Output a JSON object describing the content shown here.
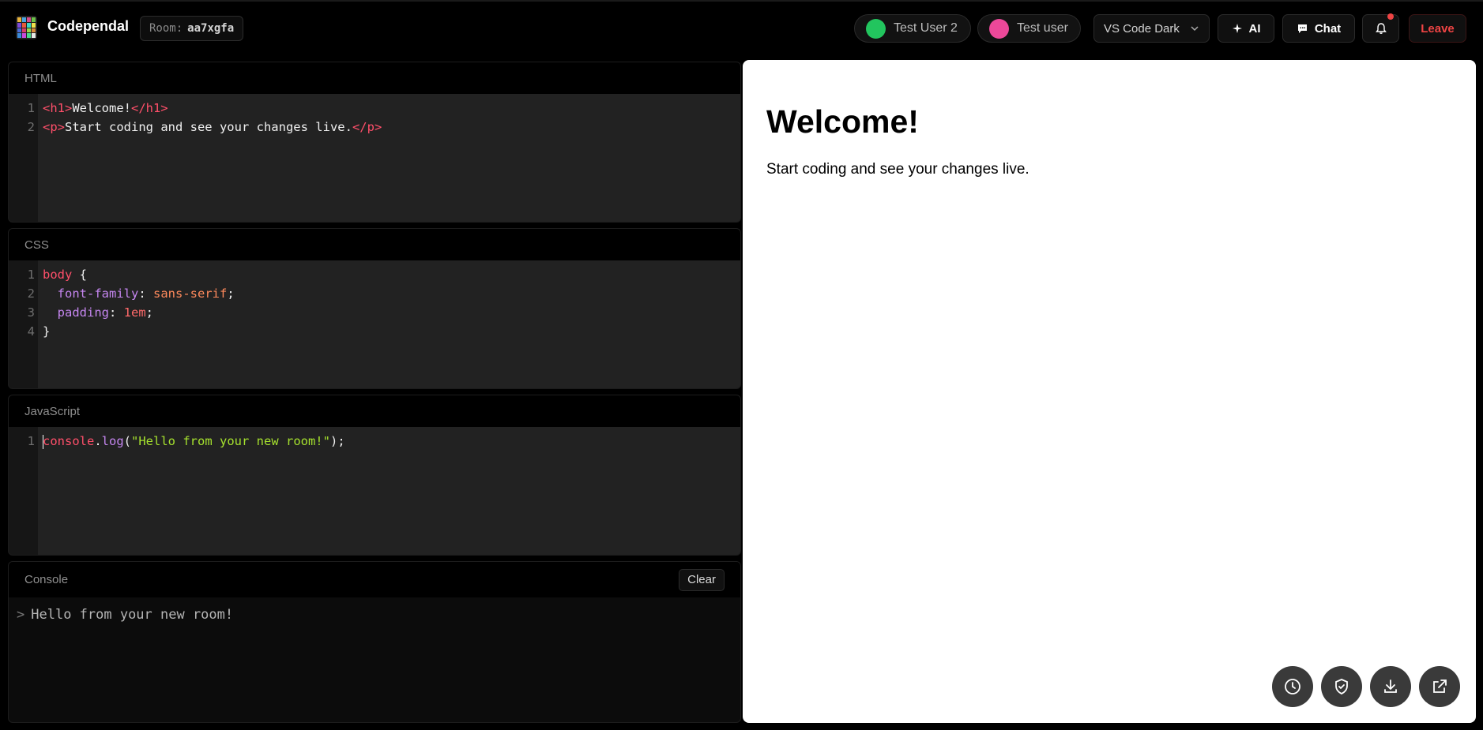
{
  "app": {
    "name": "Codependal",
    "room_label": "Room:",
    "room_id": "aa7xgfa"
  },
  "users": [
    {
      "name": "Test User 2",
      "color": "#22c55e"
    },
    {
      "name": "Test user",
      "color": "#ec4899"
    }
  ],
  "toolbar": {
    "theme": "VS Code Dark",
    "ai_label": "AI",
    "chat_label": "Chat",
    "leave_label": "Leave"
  },
  "panels": {
    "html_title": "HTML",
    "css_title": "CSS",
    "js_title": "JavaScript",
    "console_title": "Console",
    "clear_label": "Clear"
  },
  "html_code": {
    "line1": {
      "no": "1",
      "open": "<h1>",
      "text": "Welcome!",
      "close": "</h1>"
    },
    "line2": {
      "no": "2",
      "open": "<p>",
      "text": "Start coding and see your changes live.",
      "close": "</p>"
    }
  },
  "css_code": {
    "line1": {
      "no": "1",
      "selector": "body",
      "rest": " {"
    },
    "line2": {
      "no": "2",
      "prop": "font-family",
      "value": "sans-serif"
    },
    "line3": {
      "no": "3",
      "prop": "padding",
      "value": "1em"
    },
    "line4": {
      "no": "4",
      "text": "}"
    }
  },
  "js_code": {
    "line1": {
      "no": "1",
      "obj": "console",
      "method": "log",
      "arg": "\"Hello from your new room!\""
    }
  },
  "console_output": {
    "prompt": ">",
    "message": "Hello from your new room!"
  },
  "preview": {
    "heading": "Welcome!",
    "paragraph": "Start coding and see your changes live."
  },
  "preview_actions": [
    "clock-icon",
    "shield-check-icon",
    "download-icon",
    "external-link-icon"
  ]
}
